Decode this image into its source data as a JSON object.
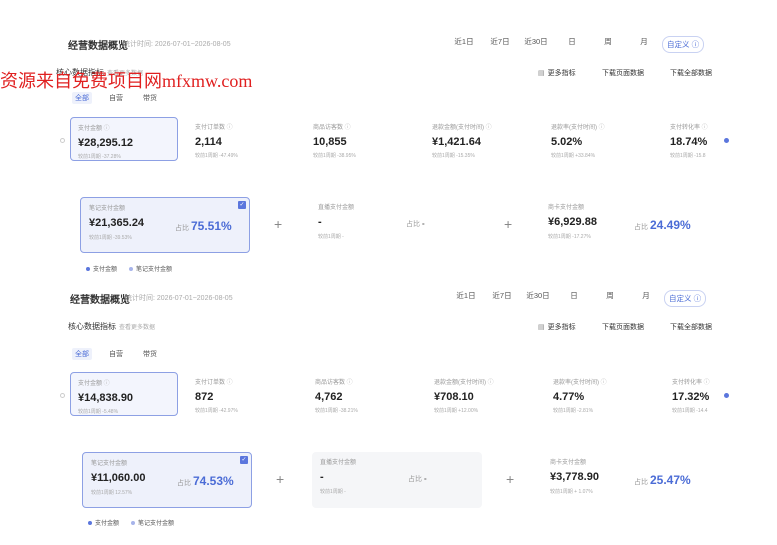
{
  "watermark": "资源来自免费项目网mfxmw.com",
  "periods": [
    "近1日",
    "近7日",
    "近30日",
    "日",
    "周",
    "月",
    "自定义 ⓘ"
  ],
  "panels": [
    {
      "title": "经营数据概览",
      "meta": "统计时间: 2026-07-01~2026-08-05",
      "section_title": "核心数据指标",
      "section_hint": "查看更多数据",
      "more_metrics": "更多指标",
      "download_page": "下载页面数据",
      "download_all": "下载全部数据",
      "subtabs": [
        "全部",
        "自营",
        "带货"
      ],
      "metrics": [
        {
          "label": "支付金额",
          "value": "¥28,295.12",
          "compare": "较前1周期 -37.28%"
        },
        {
          "label": "支付订单数",
          "value": "2,114",
          "compare": "较前1周期 -47.49%"
        },
        {
          "label": "商品访客数",
          "value": "10,855",
          "compare": "较前1周期 -38.95%"
        },
        {
          "label": "退款金额(支付时间)",
          "value": "¥1,421.64",
          "compare": "较前1周期 -15.35%"
        },
        {
          "label": "退款率(支付时间)",
          "value": "5.02%",
          "compare": "较前1周期 +33.84%"
        },
        {
          "label": "支付转化率",
          "value": "18.74%",
          "compare": "较前1周期 -15.8"
        }
      ],
      "cards": [
        {
          "label": "笔记支付金额",
          "value": "¥21,365.24",
          "compare": "较前1周期 -39.53%",
          "ratio_label": "占比",
          "ratio": "75.51%"
        },
        {
          "label": "直播支付金额",
          "value": "-",
          "compare": "较前1周期 -",
          "ratio_label": "占比",
          "ratio": "-"
        },
        {
          "label": "商卡支付金额",
          "value": "¥6,929.88",
          "compare": "较前1周期 -17.27%",
          "ratio_label": "占比",
          "ratio": "24.49%"
        }
      ],
      "legend": [
        "支付金额",
        "笔记支付金额"
      ]
    },
    {
      "title": "经营数据概览",
      "meta": "统计时间: 2026-07-01~2026-08-05",
      "section_title": "核心数据指标",
      "section_hint": "查看更多数据",
      "more_metrics": "更多指标",
      "download_page": "下载页面数据",
      "download_all": "下载全部数据",
      "subtabs": [
        "全部",
        "自营",
        "带货"
      ],
      "metrics": [
        {
          "label": "支付金额",
          "value": "¥14,838.90",
          "compare": "较前1周期 -5.48%"
        },
        {
          "label": "支付订单数",
          "value": "872",
          "compare": "较前1周期 -42.97%"
        },
        {
          "label": "商品访客数",
          "value": "4,762",
          "compare": "较前1周期 -38.21%"
        },
        {
          "label": "退款金额(支付时间)",
          "value": "¥708.10",
          "compare": "较前1周期 +12.00%"
        },
        {
          "label": "退款率(支付时间)",
          "value": "4.77%",
          "compare": "较前1周期 -2.81%"
        },
        {
          "label": "支付转化率",
          "value": "17.32%",
          "compare": "较前1周期 -14.4"
        }
      ],
      "cards": [
        {
          "label": "笔记支付金额",
          "value": "¥11,060.00",
          "compare": "较前1周期 12.57%",
          "ratio_label": "占比",
          "ratio": "74.53%"
        },
        {
          "label": "直播支付金额",
          "value": "-",
          "compare": "较前1周期 -",
          "ratio_label": "占比",
          "ratio": "-"
        },
        {
          "label": "商卡支付金额",
          "value": "¥3,778.90",
          "compare": "较前1周期 + 1.07%",
          "ratio_label": "占比",
          "ratio": "25.47%"
        }
      ],
      "legend": [
        "支付金额",
        "笔记支付金额"
      ]
    }
  ]
}
